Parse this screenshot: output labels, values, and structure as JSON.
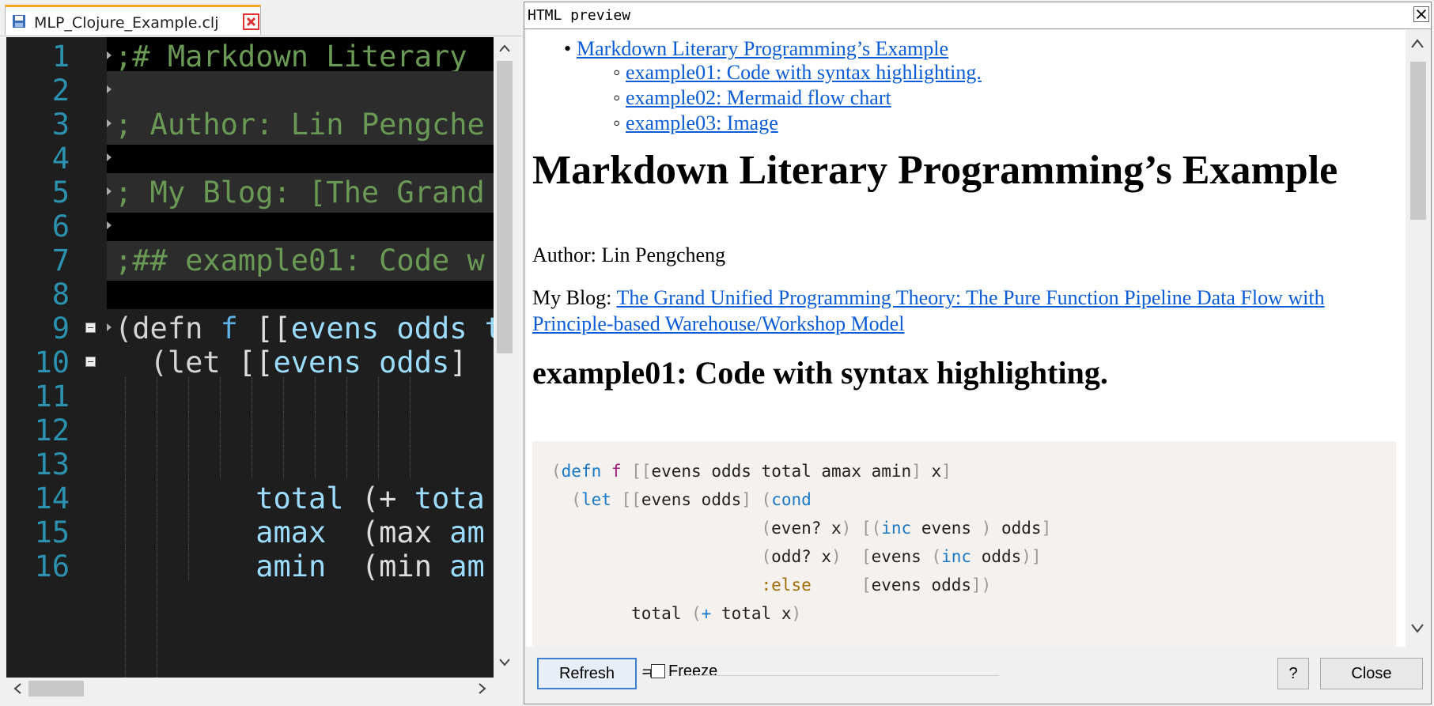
{
  "editor": {
    "tab_label": "MLP_Clojure_Example.clj",
    "lines": [
      {
        "num": "1",
        "text": ";# Markdown Literary"
      },
      {
        "num": "2",
        "text": ""
      },
      {
        "num": "3",
        "text": "; Author: Lin Pengche"
      },
      {
        "num": "4",
        "text": ""
      },
      {
        "num": "5",
        "text": "; My Blog: [The Grand"
      },
      {
        "num": "6",
        "text": ""
      },
      {
        "num": "7",
        "text": ";## example01: Code w"
      },
      {
        "num": "8",
        "text": ""
      },
      {
        "num": "9",
        "t1": "(defn ",
        "t2": "f",
        "t3": " [[",
        "t4": "evens odds",
        "t5": " t"
      },
      {
        "num": "10",
        "t1": "  (let ",
        "t2": "[[",
        "t3": "evens odds",
        "t4": "]"
      },
      {
        "num": "11",
        "text": ""
      },
      {
        "num": "12",
        "text": ""
      },
      {
        "num": "13",
        "text": ""
      },
      {
        "num": "14",
        "t1": "        total",
        "t2": " (+ ",
        "t3": "tota"
      },
      {
        "num": "15",
        "t1": "        amax",
        "t2": "  (max ",
        "t3": "am"
      },
      {
        "num": "16",
        "t1": "        amin",
        "t2": "  (min ",
        "t3": "am"
      }
    ]
  },
  "preview": {
    "title": "HTML preview",
    "toc": {
      "top": "Markdown Literary Programming’s Example",
      "items": [
        "example01: Code with syntax highlighting.",
        "example02: Mermaid flow chart",
        "example03: Image"
      ]
    },
    "heading1": "Markdown Literary Programming’s Example",
    "author": "Author: Lin Pengcheng",
    "blog_prefix": "My Blog: ",
    "blog_link_line1": "The Grand Unified Programming Theory: The Pure Function Pipeline Data Flow with",
    "blog_link_line2": "Principle-based Warehouse/Workshop Model",
    "heading2": "example01: Code with syntax highlighting.",
    "code": {
      "l1": {
        "a": "(",
        "b": "defn",
        "c": " ",
        "d": "f",
        "e": " [[",
        "f": "evens odds total amax amin",
        "g": "]",
        "h": " x",
        "i": "]"
      },
      "l2": {
        "a": "  (",
        "b": "let",
        "c": " [[",
        "d": "evens odds",
        "e": "] (",
        "f": "cond"
      },
      "l3": {
        "a": "                     (",
        "b": "even? x",
        "c": ") [(",
        "d": "inc",
        "e": " evens ",
        "f": ")",
        "g": " odds",
        "h": "]"
      },
      "l4": {
        "a": "                     (",
        "b": "odd? x",
        "c": ")  [",
        "d": "evens ",
        "e": "(",
        "f": "inc",
        "g": " odds",
        "h": ")]"
      },
      "l5": {
        "a": "                     ",
        "b": ":else",
        "c": "     [",
        "d": "evens odds",
        "e": "])"
      },
      "l6": {
        "a": "        total ",
        "b": "(",
        "c": "+",
        "d": " total x",
        "e": ")"
      }
    },
    "buttons": {
      "refresh": "Refresh",
      "freeze": "Freeze",
      "help": "?",
      "close": "Close"
    },
    "freeze_glyph": "ㅋ"
  }
}
